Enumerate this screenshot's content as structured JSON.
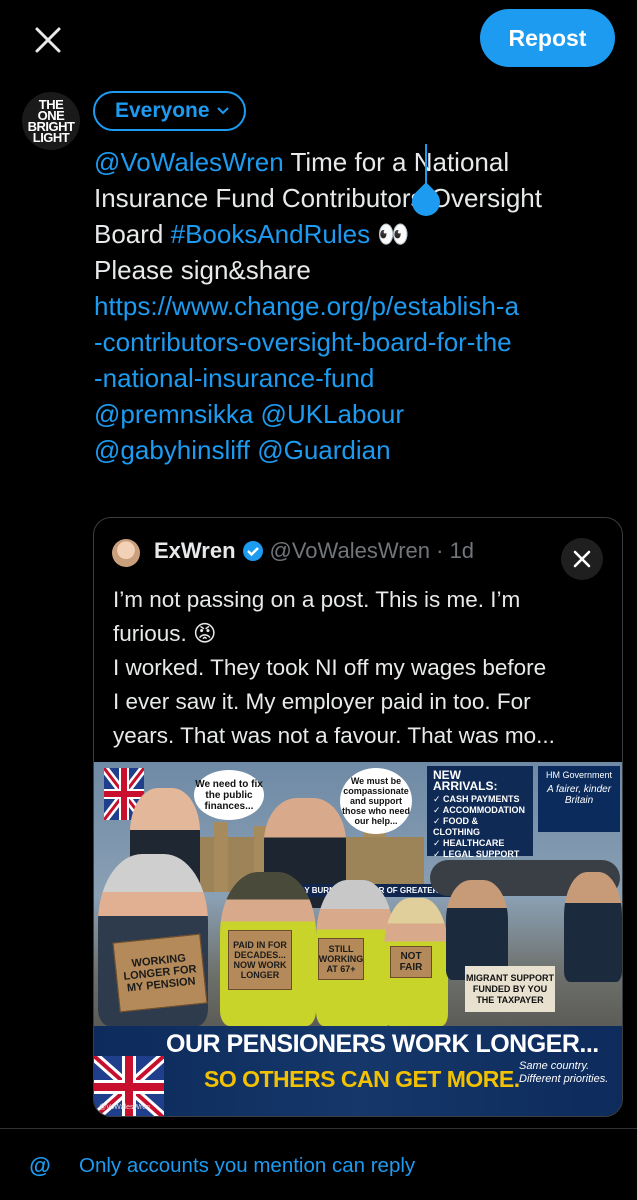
{
  "topbar": {
    "close_icon": "close-icon",
    "repost_label": "Repost"
  },
  "avatar": {
    "logo_text": [
      "THE",
      "ONE",
      "BRIGHT",
      "LIGHT"
    ]
  },
  "audience": {
    "label": "Everyone",
    "icon": "chevron-down-icon"
  },
  "compose": {
    "mention": "@VoWalesWren",
    "text1": " Time for a National",
    "text2": "Insurance Fund Contributors Oversight",
    "text3": "Board ",
    "hashtag": "#BooksAndRules",
    "emoji": " 👀",
    "text4": "Please sign&share",
    "url1": "https://www.change.org/p/establish-a",
    "url2": "-contributors-oversight-board-for-the",
    "url3": "-national-insurance-fund",
    "mentions1": "@premnsikka @UKLabour",
    "mentions2": "@gabyhinsliff @Guardian"
  },
  "quote": {
    "name": "ExWren",
    "handle": "@VoWalesWren · 1d",
    "verified_icon": "verified-badge-icon",
    "lines": [
      "I’m not passing on a post. This is me. I’m",
      "furious. 😡",
      "I worked. They took NI off my wages before",
      "I ever saw it. My employer paid in too. For",
      "years. That was not a favour. That was mo..."
    ],
    "image": {
      "bubble1": "We need to fix the public finances...",
      "bubble2": "We must be compassionate and support those who need our help...",
      "nameplate": "ANDY BURNHAM MAYOR OF GREATER MANCHESTER",
      "arrivals_title": "NEW ARRIVALS:",
      "arrivals_items": [
        "✓ CASH PAYMENTS",
        "✓ ACCOMMODATION",
        "✓ FOOD & CLOTHING",
        "✓ HEALTHCARE",
        "✓ LEGAL SUPPORT"
      ],
      "hmgov": "HM Government",
      "hmgov_slogan": "A fairer, kinder Britain",
      "sign1": "WORKING LONGER FOR MY PENSION",
      "sign2": "PAID IN FOR DECADES... NOW WORK LONGER",
      "sign3": "STILL WORKING AT 67+",
      "sign4": "NOT FAIR",
      "migrant_sign": "MIGRANT SUPPORT FUNDED BY YOU THE TAXPAYER",
      "headline1": "OUR PENSIONERS WORK LONGER...",
      "headline2": "SO OTHERS CAN GET MORE.",
      "tagline": "Same country. Different priorities.",
      "credit": "@VoWalesWren"
    }
  },
  "reply": {
    "icon": "@",
    "label": "Only accounts you mention can reply"
  }
}
